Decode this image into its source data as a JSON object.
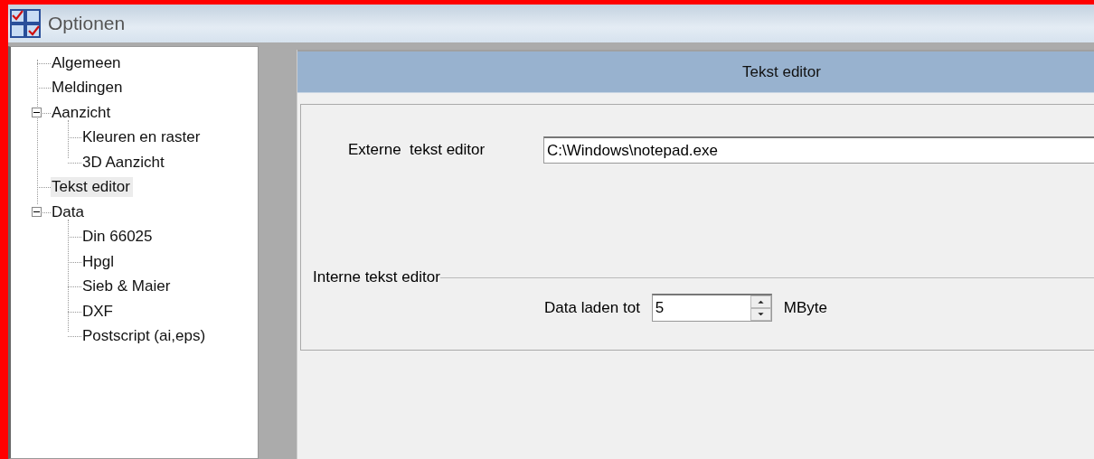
{
  "window": {
    "title": "Optionen"
  },
  "tree": [
    {
      "label": "Algemeen",
      "selected": false
    },
    {
      "label": "Meldingen",
      "selected": false
    },
    {
      "label": "Aanzicht",
      "selected": false,
      "expanded": true,
      "children": [
        {
          "label": "Kleuren en raster",
          "selected": false
        },
        {
          "label": "3D Aanzicht",
          "selected": false
        }
      ]
    },
    {
      "label": "Tekst editor",
      "selected": true
    },
    {
      "label": "Data",
      "selected": false,
      "expanded": true,
      "children": [
        {
          "label": "Din 66025",
          "selected": false
        },
        {
          "label": "Hpgl",
          "selected": false
        },
        {
          "label": "Sieb & Maier",
          "selected": false
        },
        {
          "label": "DXF",
          "selected": false
        },
        {
          "label": "Postscript (ai,eps)",
          "selected": false
        }
      ]
    }
  ],
  "panel": {
    "header": "Tekst editor",
    "external_label": "Externe  tekst editor",
    "external_value": "C:\\Windows\\notepad.exe",
    "group_title": "Interne tekst editor",
    "load_label": "Data laden tot",
    "load_value": "5",
    "load_unit": "MByte"
  }
}
